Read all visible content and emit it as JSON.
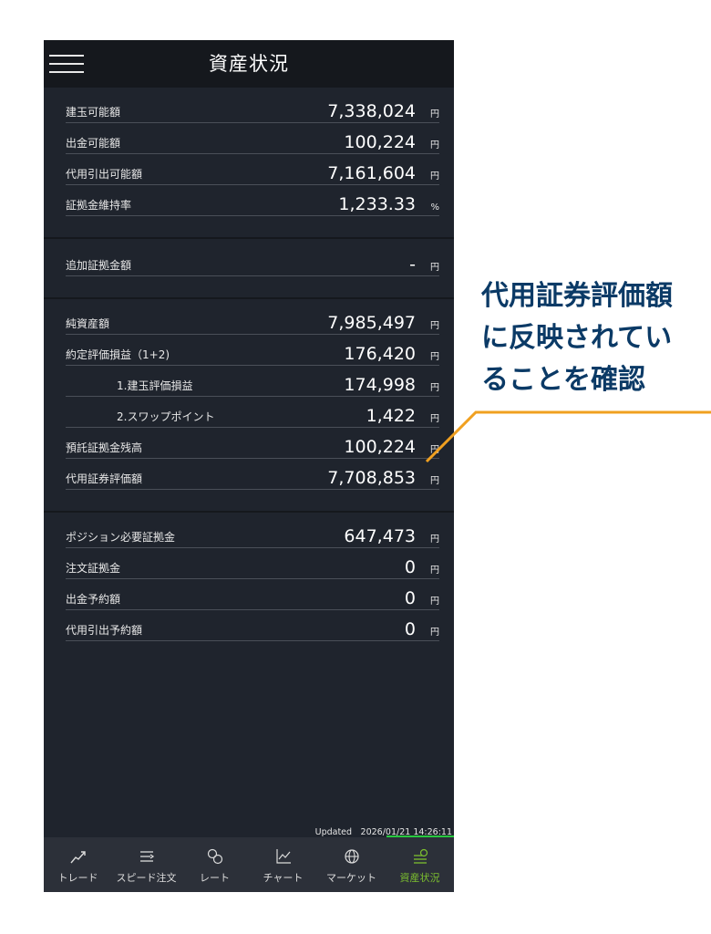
{
  "header": {
    "title": "資産状況"
  },
  "section1": [
    {
      "label": "建玉可能額",
      "value": "7,338,024",
      "unit": "円"
    },
    {
      "label": "出金可能額",
      "value": "100,224",
      "unit": "円"
    },
    {
      "label": "代用引出可能額",
      "value": "7,161,604",
      "unit": "円"
    },
    {
      "label": "証拠金維持率",
      "value": "1,233.33",
      "unit": "%"
    }
  ],
  "section2": [
    {
      "label": "追加証拠金額",
      "value": "-",
      "unit": "円"
    }
  ],
  "section3": [
    {
      "label": "純資産額",
      "value": "7,985,497",
      "unit": "円"
    },
    {
      "label": "約定評価損益（1+2)",
      "value": "176,420",
      "unit": "円"
    },
    {
      "label": "1.建玉評価損益",
      "value": "174,998",
      "unit": "円"
    },
    {
      "label": "2.スワップポイント",
      "value": "1,422",
      "unit": "円"
    },
    {
      "label": "預託証拠金残高",
      "value": "100,224",
      "unit": "円"
    },
    {
      "label": "代用証券評価額",
      "value": "7,708,853",
      "unit": "円"
    }
  ],
  "section4": [
    {
      "label": "ポジション必要証拠金",
      "value": "647,473",
      "unit": "円"
    },
    {
      "label": "注文証拠金",
      "value": "0",
      "unit": "円"
    },
    {
      "label": "出金予約額",
      "value": "0",
      "unit": "円"
    },
    {
      "label": "代用引出予約額",
      "value": "0",
      "unit": "円"
    }
  ],
  "updated": "Updated　2026/01/21 14:26:11",
  "tabs": [
    {
      "label": "トレード",
      "icon": "trade-chart-icon"
    },
    {
      "label": "スピード注文",
      "icon": "speed-order-icon"
    },
    {
      "label": "レート",
      "icon": "rate-coins-icon"
    },
    {
      "label": "チャート",
      "icon": "line-chart-icon"
    },
    {
      "label": "マーケット",
      "icon": "globe-icon"
    },
    {
      "label": "資産状況",
      "icon": "assets-icon"
    }
  ],
  "callout": {
    "lines": [
      "代用証券評価額",
      "に反映されてい",
      "ることを確認"
    ]
  },
  "colors": {
    "background": "#1f242d",
    "header": "#15181d",
    "active_tab": "#7cbf2f",
    "callout_text": "#0b3a66",
    "leader_line": "#f0a020"
  }
}
